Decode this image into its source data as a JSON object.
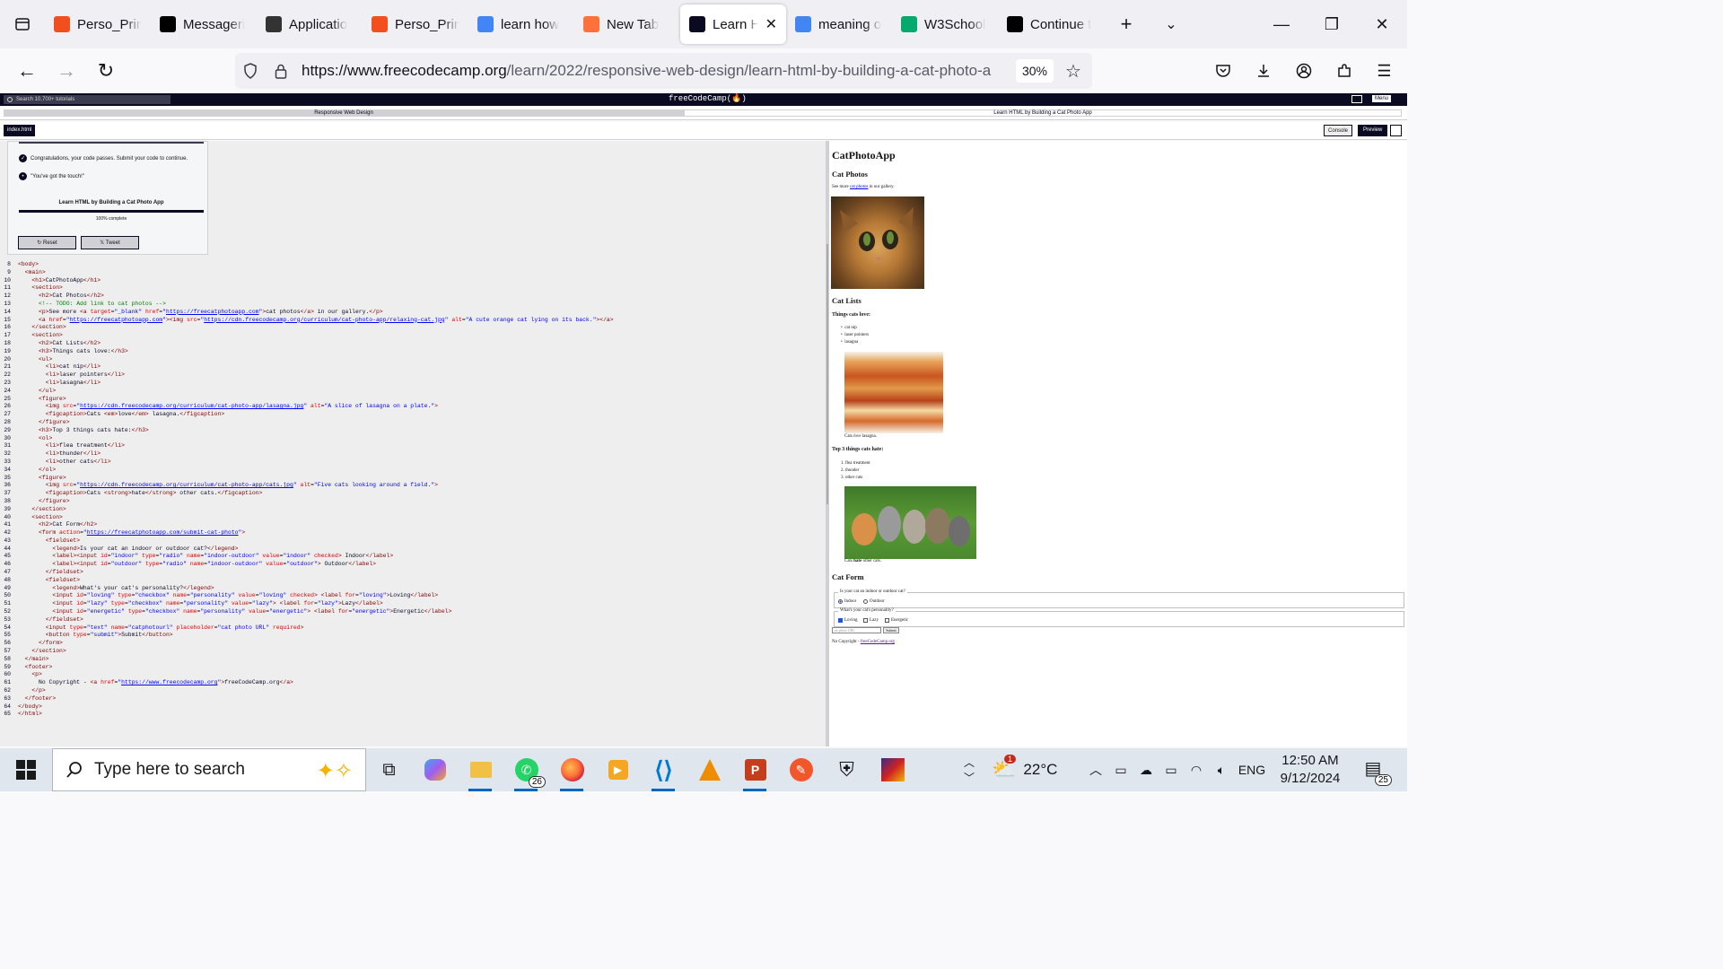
{
  "browser": {
    "tabs": [
      {
        "title": "Perso_Prim",
        "icon": "figma-icon",
        "color": "#f24e1e"
      },
      {
        "title": "Messageri",
        "icon": "figma-icon",
        "color": "#000000"
      },
      {
        "title": "Applicatio",
        "icon": "openai-icon",
        "color": "#333333"
      },
      {
        "title": "Perso_Prim",
        "icon": "figma-icon",
        "color": "#f24e1e"
      },
      {
        "title": "learn how",
        "icon": "google-icon",
        "color": "#4285f4"
      },
      {
        "title": "New Tab",
        "icon": "firefox-icon",
        "color": "#ff7139"
      },
      {
        "title": "Learn H",
        "icon": "freecodecamp-icon",
        "color": "#0a0a23",
        "active": true
      },
      {
        "title": "meaning o",
        "icon": "google-icon",
        "color": "#4285f4"
      },
      {
        "title": "W3School",
        "icon": "w3schools-icon",
        "color": "#04aa6d"
      },
      {
        "title": "Continue t",
        "icon": "medium-icon",
        "color": "#000000"
      }
    ],
    "url_domain": "https://www.freecodecamp.org",
    "url_path": "/learn/2022/responsive-web-design/learn-html-by-building-a-cat-photo-a",
    "zoom": "30%"
  },
  "fcc": {
    "search_placeholder": "Search 10,700+ tutorials",
    "logo": "freeCodeCamp(🔥)",
    "menu": "Menu",
    "breadcrumb_1": "Responsive Web Design",
    "breadcrumb_2": "Learn HTML by Building a Cat Photo App",
    "file_tab": "index.html",
    "console_btn": "Console",
    "preview_btn": "Preview",
    "passed_msg": "Congratulations, your code passes. Submit your code to continue.",
    "hint_msg": "\"You've got the touch!\"",
    "course_title": "Learn HTML by Building a Cat Photo App",
    "progress_text": "100% complete",
    "progress_fraction": 1.0,
    "reset_btn": "Reset",
    "tweet_btn": "Tweet"
  },
  "preview": {
    "h1": "CatPhotoApp",
    "h2_photos": "Cat Photos",
    "see_more_pre": "See more",
    "see_more_link": "cat photos",
    "see_more_post": "in our gallery.",
    "h2_lists": "Cat Lists",
    "h3_love": "Things cats love:",
    "love_items": [
      "cat nip",
      "laser pointers",
      "lasagna"
    ],
    "love_caption_pre": "Cats",
    "love_caption_em": "love",
    "love_caption_post": "lasagna.",
    "h3_hate": "Top 3 things cats hate:",
    "hate_items": [
      "flea treatment",
      "thunder",
      "other cats"
    ],
    "hate_caption_pre": "Cats",
    "hate_caption_strong": "hate",
    "hate_caption_post": "other cats.",
    "h2_form": "Cat Form",
    "legend_1": "Is your cat an indoor or outdoor cat?",
    "radio_indoor": "Indoor",
    "radio_outdoor": "Outdoor",
    "legend_2": "What's your cat's personality?",
    "cb_loving": "Loving",
    "cb_lazy": "Lazy",
    "cb_energetic": "Energetic",
    "input_placeholder": "cat photo URL",
    "submit": "Submit",
    "footer_pre": "No Copyright -",
    "footer_link": "freeCodeCamp.org"
  },
  "taskbar": {
    "search_placeholder": "Type here to search",
    "whatsapp_badge": "26",
    "weather_temp": "22°C",
    "weather_badge": "1",
    "language": "ENG",
    "time": "12:50 AM",
    "date": "9/12/2024",
    "notif_badge": "25"
  }
}
